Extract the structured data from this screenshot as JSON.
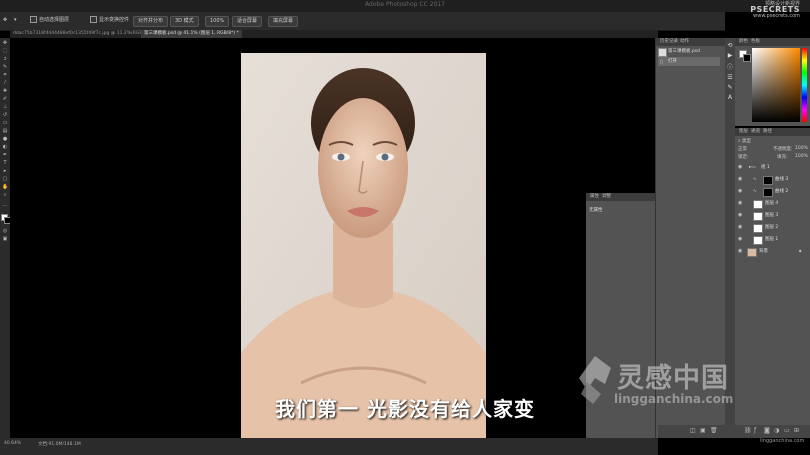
{
  "window": {
    "title": "Adobe Photoshop CC 2017"
  },
  "watermark_top": {
    "line1": "领略设计新视界",
    "brand": "PSECRETS",
    "line3": "www.psecrets.com"
  },
  "options_bar": {
    "auto_select_label": "自动选择图层 ",
    "show_transform_label": "显示变换控件",
    "btn1": "对齐并分布",
    "btn2": "3D 模式",
    "zoom": "100%",
    "btn3": "适合屏幕",
    "btn4": "填充屏幕"
  },
  "doc_tabs": [
    {
      "label": "ddac75b7318f4444488ef0c1355f49f7c.jpg @ 11.2%(RGB/8#) ×"
    },
    {
      "label": "第三课模板.psd @ 41.1% (图层 1, RGB/8*) *"
    }
  ],
  "status_bar": {
    "zoom": "40.64%",
    "doc_info": "文档:91.0M/148.1M"
  },
  "history_panel": {
    "tabs": [
      "历史记录",
      "动作"
    ],
    "items": [
      "第三课模板.psd",
      "打开"
    ]
  },
  "properties_panel": {
    "tabs": [
      "属性",
      "调整"
    ],
    "content": "无属性"
  },
  "color_panel": {
    "tabs": [
      "颜色",
      "色板"
    ]
  },
  "layers_panel": {
    "tabs": [
      "图层",
      "通道",
      "路径"
    ],
    "filter_label": "类型",
    "blend_mode": "正常",
    "opacity_label": "不透明度:",
    "opacity_value": "100%",
    "lock_label": "锁定:",
    "fill_label": "填充:",
    "fill_value": "100%",
    "layers": [
      {
        "name": "组 1"
      },
      {
        "name": "曲线 3"
      },
      {
        "name": "曲线 2"
      },
      {
        "name": "图层 4"
      },
      {
        "name": "图层 3"
      },
      {
        "name": "图层 2"
      },
      {
        "name": "图层 1"
      },
      {
        "name": "背景"
      }
    ]
  },
  "subtitle": "我们第一 光影没有给人家变",
  "logo": {
    "text_cn": "灵感中国",
    "url": "lingganchina.com"
  },
  "watermark_bottom": "lingganchina.com",
  "colors": {
    "panel_bg": "#535353",
    "bar_bg": "#2b2b2b",
    "accent_orange": "#ff8a00"
  }
}
